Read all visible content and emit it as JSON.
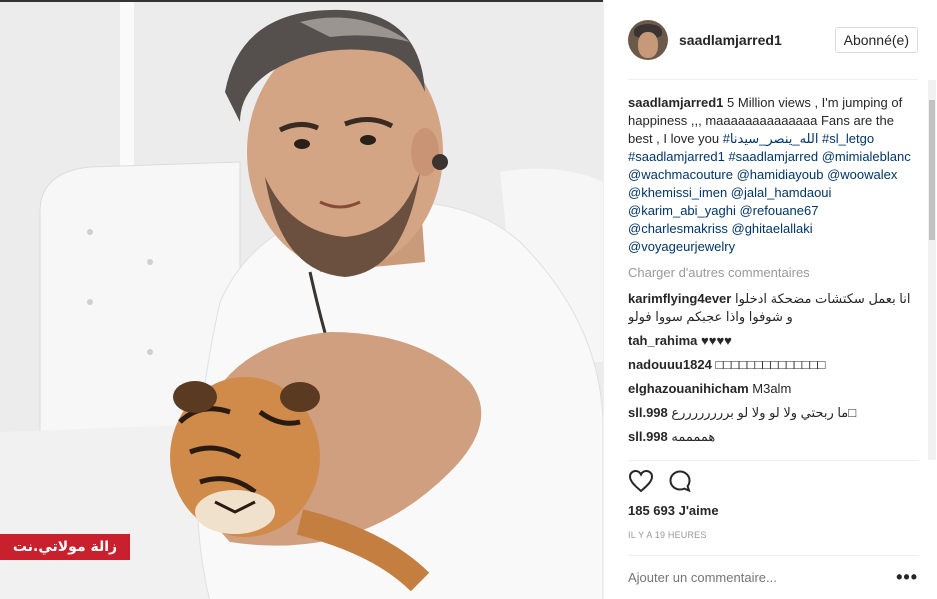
{
  "watermark": "زالة مولاتي.نت",
  "post": {
    "username": "saadlamjarred1",
    "follow_label": "Abonné(e)",
    "caption": {
      "user": "saadlamjarred1",
      "text": "5 Million views , I'm jumping of happiness ,,, maaaaaaaaaaaaaa Fans are the best , I love you",
      "hashtags": "#الله_ينصر_سيدنا #sl_letgo #saadlamjarred1 #saadlamjarred",
      "mentions": "@mimialeblanc @wachmacouture @hamidiayoub @woowalex @khemissi_imen @jalal_hamdaoui @karim_abi_yaghi @refouane67 @charlesmakriss @ghitaelallaki @voyageurjewelry"
    },
    "load_more": "Charger d'autres commentaires",
    "comments": [
      {
        "user": "karimflying4ever",
        "text": "انا بعمل سكتشات مضحكة ادخلوا و شوفوا واذا عجبكم سووا فولو"
      },
      {
        "user": "tah_rahima",
        "text": "♥♥♥♥"
      },
      {
        "user": "nadouuu1824",
        "text": "□□□□□□□□□□□□□□"
      },
      {
        "user": "elghazouanihicham",
        "text": "M3alm"
      },
      {
        "user": "sll.998",
        "text": "□ما ربحتي ولا لو ولا لو بررررررررع"
      },
      {
        "user": "sll.998",
        "text": "هممممه"
      }
    ],
    "likes": "185 693 J'aime",
    "time": "IL Y A 19 HEURES",
    "add_comment_placeholder": "Ajouter un commentaire...",
    "more_symbol": "•••"
  },
  "icons": {
    "like": "heart-icon",
    "comment": "comment-bubble-icon",
    "more": "more-options-icon"
  }
}
